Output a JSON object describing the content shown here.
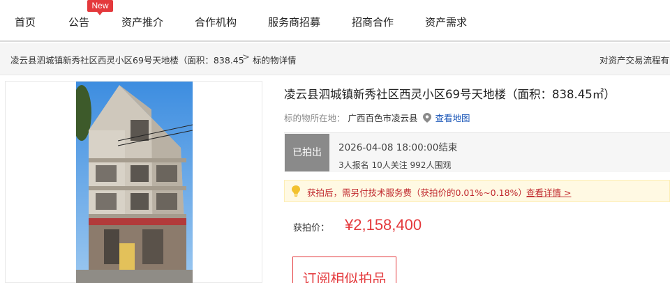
{
  "nav": {
    "items": [
      {
        "label": "首页"
      },
      {
        "label": "公告"
      },
      {
        "label": "资产推介"
      },
      {
        "label": "合作机构"
      },
      {
        "label": "服务商招募"
      },
      {
        "label": "招商合作"
      },
      {
        "label": "资产需求"
      }
    ],
    "new_badge": "New"
  },
  "breadcrumb": {
    "item1": "凌云县泗城镇新秀社区西灵小区69号天地楼（面积：838.45",
    "separator": ">",
    "item2": "标的物详情",
    "flow_link": "对资产交易流程有"
  },
  "detail": {
    "title": "凌云县泗城镇新秀社区西灵小区69号天地楼（面积：838.45㎡）",
    "location_label": "标的物所在地：",
    "location_value": "广西百色市凌云县",
    "map_link": "查看地图",
    "status": "已拍出",
    "end_time": "2026-04-08 18:00:00结束",
    "stats": "3人报名  10人关注  992人围观",
    "notice_text": "获拍后，需另付技术服务费（获拍价的0.01%~0.18%）",
    "notice_link": "查看详情 >",
    "price_label": "获拍价：",
    "price_value": "¥2,158,400",
    "subscribe_button": "订阅相似拍品"
  },
  "colors": {
    "accent_red": "#e4393c",
    "status_gray": "#8a8a8a",
    "link_blue": "#1a56b8",
    "notice_bg": "#fff9e3"
  }
}
